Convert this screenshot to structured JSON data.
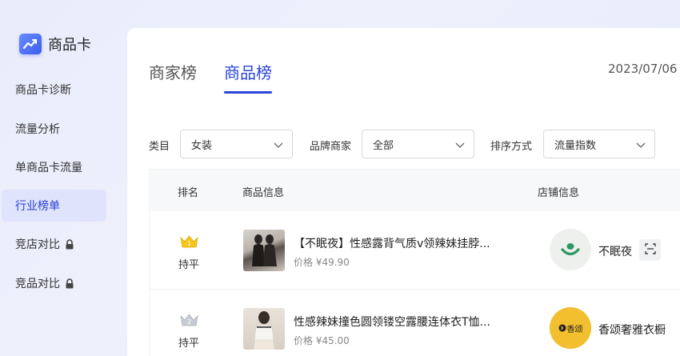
{
  "brand": {
    "label": "商品卡"
  },
  "sidebar": {
    "items": [
      {
        "label": "商品卡诊断"
      },
      {
        "label": "流量分析"
      },
      {
        "label": "单商品卡流量"
      },
      {
        "label": "行业榜单"
      },
      {
        "label": "竞店对比"
      },
      {
        "label": "竞品对比"
      }
    ]
  },
  "tabs": [
    {
      "label": "商家榜"
    },
    {
      "label": "商品榜"
    }
  ],
  "date": "2023/07/06",
  "filters": {
    "category": {
      "label": "类目",
      "value": "女装"
    },
    "brand": {
      "label": "品牌商家",
      "value": "全部"
    },
    "sort": {
      "label": "排序方式",
      "value": "流量指数"
    }
  },
  "table": {
    "headers": {
      "rank": "排名",
      "product": "商品信息",
      "shop": "店铺信息"
    },
    "rows": [
      {
        "rank_badge": "1",
        "rank_change": "持平",
        "title": "【不眠夜】性感露背气质v领辣妹挂脖...",
        "price": "价格 ¥49.90",
        "shop": "不眠夜"
      },
      {
        "rank_badge": "2",
        "rank_change": "持平",
        "title": "性感辣妹撞色圆领镂空露腰连体衣T恤...",
        "price": "价格 ¥45.00",
        "shop": "香颂奢雅衣橱",
        "shop_logo_text": "香颂"
      }
    ]
  },
  "colors": {
    "accent": "#2a45d8",
    "active_nav_bg": "#dfe3fb",
    "gold": "#f5c518",
    "silver": "#c8ccd4"
  }
}
